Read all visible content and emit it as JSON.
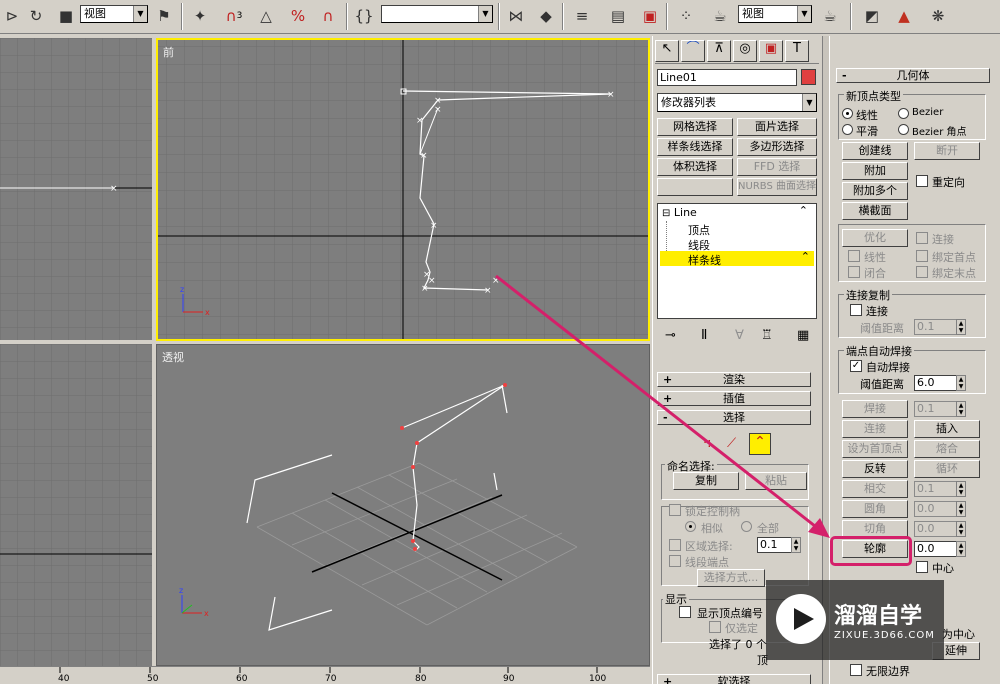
{
  "toolbar": {
    "view_dropdown_1": "视图",
    "view_dropdown_2": "视图",
    "icons": [
      "select-object-icon",
      "undo-redo-icon",
      "select-region-icon",
      "mirror-icon",
      "snap-toggle-icon",
      "angle-snap-icon",
      "percent-snap-icon",
      "spinner-snap-icon",
      "named-selection-icon",
      "mirror-tool-icon",
      "align-icon",
      "layer-icon",
      "curve-editor-icon",
      "schematic-icon",
      "material-editor-icon",
      "render-scene-icon",
      "teapot-render-icon",
      "quick-render-icon"
    ],
    "snap_labels": {
      "snap": "3",
      "angle": "△",
      "percent": "%"
    }
  },
  "viewports": {
    "front": {
      "label": "前",
      "active": true
    },
    "perspective": {
      "label": "透视"
    }
  },
  "command_panel": {
    "tabs": [
      "create-tab-icon",
      "modify-tab-icon",
      "hierarchy-tab-icon",
      "motion-tab-icon",
      "display-tab-icon",
      "utilities-tab-icon"
    ],
    "object_name": "Line01",
    "object_color": "#e04040",
    "modifier_list": "修改器列表",
    "modifier_buttons": [
      "网格选择",
      "面片选择",
      "样条线选择",
      "多边形选择",
      "体积选择",
      "FFD 选择",
      "",
      "NURBS 曲面选择"
    ],
    "stack": {
      "root": "Line",
      "children": [
        "顶点",
        "线段",
        "样条线"
      ],
      "selected": "样条线"
    },
    "rollouts": {
      "render": "渲染",
      "interpolation": "插值",
      "selection": "选择"
    },
    "selection": {
      "named_selection_label": "命名选择:",
      "copy": "复制",
      "paste": "粘贴",
      "lock_handles": "锁定控制柄",
      "similar": "相似",
      "all": "全部",
      "area_select": "区域选择:",
      "area_value": "0.1",
      "segment_end": "线段端点",
      "select_by": "选择方式...",
      "display_label": "显示",
      "show_vertex_numbers": "显示顶点编号",
      "only_selected": "仅选定",
      "selected_count": "选择了 0 个",
      "partial": "顶"
    },
    "soft_selection": "软选择"
  },
  "geometry": {
    "title": "几何体",
    "new_vertex_type": "新顶点类型",
    "linear": "线性",
    "bezier": "Bezier",
    "smooth": "平滑",
    "bezier_corner": "Bezier 角点",
    "create_line": "创建线",
    "break": "断开",
    "attach": "附加",
    "reorient": "重定向",
    "attach_multiple": "附加多个",
    "cross_section": "横截面",
    "refine": "优化",
    "connect": "连接",
    "linear2": "线性",
    "bind_first": "绑定首点",
    "closed": "闭合",
    "bind_last": "绑定末点",
    "connect_copy": "连接复制",
    "connect_copy_chk": "连接",
    "threshold": "阈值距离",
    "threshold_value": "0.1",
    "end_auto_weld": "端点自动焊接",
    "auto_weld": "自动焊接",
    "auto_threshold": "阈值距离",
    "auto_threshold_value": "6.0",
    "weld": "焊接",
    "weld_value": "0.1",
    "connect2": "连接",
    "insert": "插入",
    "make_first": "设为首顶点",
    "fuse": "熔合",
    "reverse": "反转",
    "cycle": "循环",
    "crossinsert": "相交",
    "crossinsert_value": "0.1",
    "fillet": "圆角",
    "fillet_value": "0.0",
    "chamfer": "切角",
    "chamfer_value": "0.0",
    "outline": "轮廓",
    "outline_value": "0.0",
    "center": "中心",
    "as_center": "为中心",
    "extend": "延伸",
    "infinite_bounds": "无限边界"
  },
  "ruler": {
    "ticks": [
      "40",
      "50",
      "60",
      "70",
      "80",
      "90",
      "100"
    ]
  },
  "watermark": {
    "brand": "溜溜自学",
    "url": "ZIXUE.3D66.COM"
  },
  "annotation": {
    "highlight_color": "#d4206a"
  }
}
